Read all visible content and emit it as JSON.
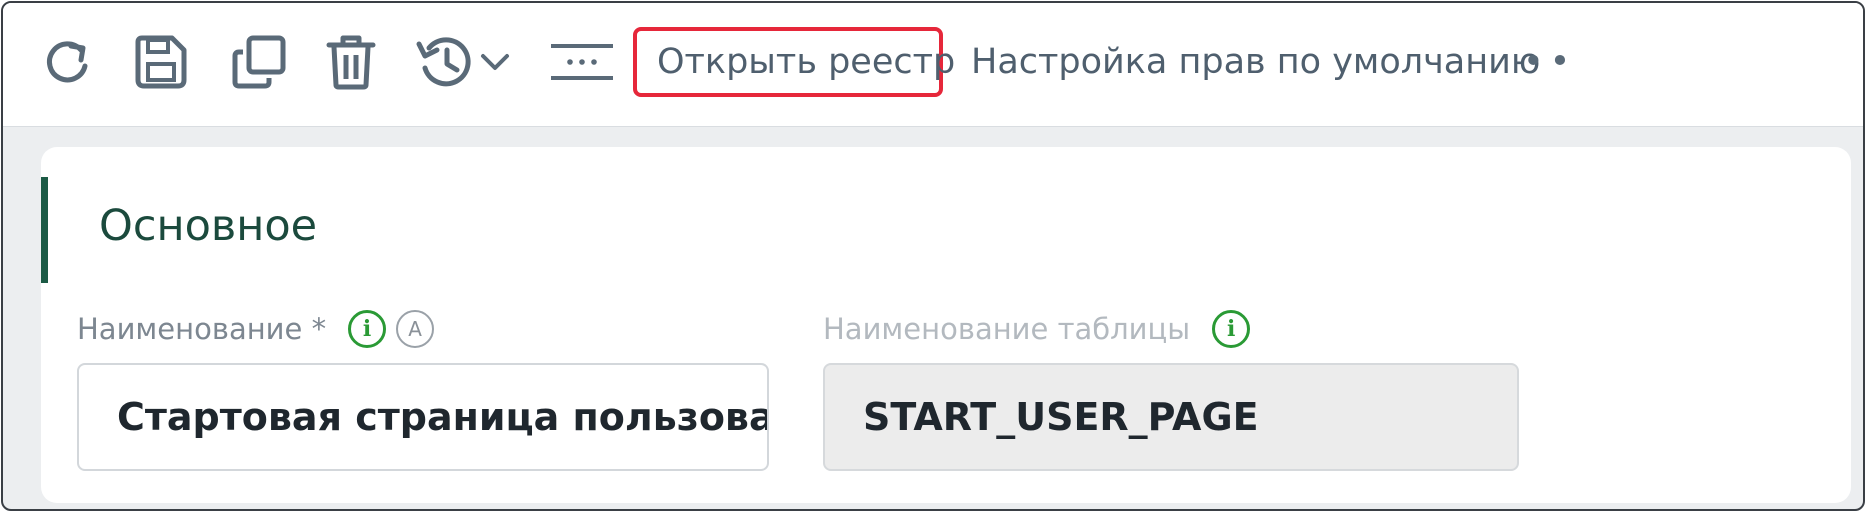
{
  "toolbar": {
    "icons": [
      "refresh-icon",
      "save-icon",
      "copy-icon",
      "delete-icon",
      "history-icon",
      "chevron-down-icon",
      "more-menu-icon"
    ],
    "open_registry_label": "Открыть реестр",
    "default_rights_label": "Настройка прав по умолчанию",
    "overflow_label": "••",
    "highlight_color": "#e6273a"
  },
  "section": {
    "title": "Основное",
    "accent_color": "#1b5a45"
  },
  "fields": {
    "name": {
      "label": "Наименование *",
      "info_glyph": "i",
      "auto_glyph": "A",
      "value": "Стартовая страница пользова..."
    },
    "table_name": {
      "label": "Наименование таблицы",
      "info_glyph": "i",
      "value": "START_USER_PAGE"
    }
  }
}
